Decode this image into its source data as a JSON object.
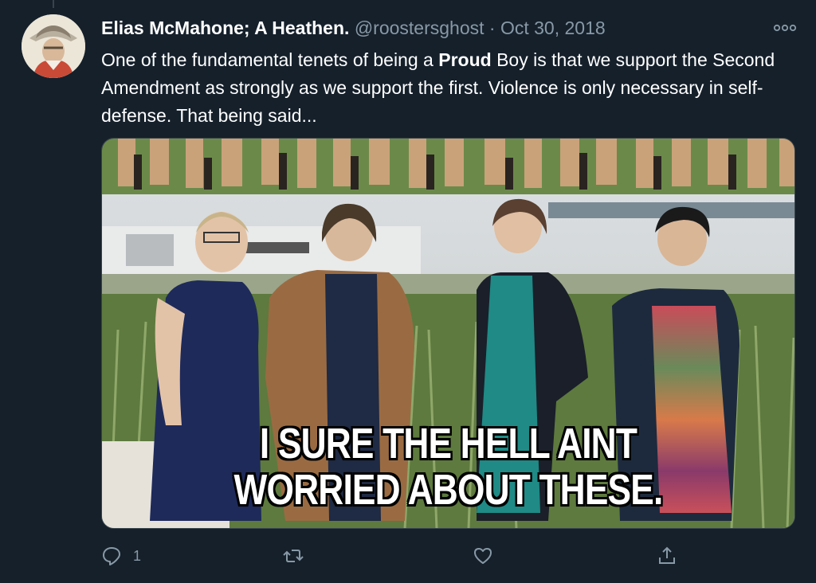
{
  "tweet": {
    "display_name": "Elias McMahone; A Heathen.",
    "handle": "@roostersghost",
    "separator": "·",
    "date": "Oct 30, 2018",
    "text_part1": "One of the fundamental tenets of being a ",
    "text_bold": "Proud",
    "text_part2": " Boy is that we support the Second Amendment as strongly as we support the first. Violence is only necessary in self-defense. That being said...",
    "avatar_icon": "avatar-image",
    "more_icon": "more-options-icon"
  },
  "media": {
    "caption_line1": "I SURE THE HELL AINT",
    "caption_line2": "WORRIED ABOUT THESE."
  },
  "actions": {
    "reply_count": "1",
    "reply_icon": "reply-icon",
    "retweet_icon": "retweet-icon",
    "like_icon": "like-icon",
    "share_icon": "share-icon"
  },
  "colors": {
    "background": "#15202b",
    "secondary_text": "#8899a6",
    "primary_text": "#ffffff"
  }
}
